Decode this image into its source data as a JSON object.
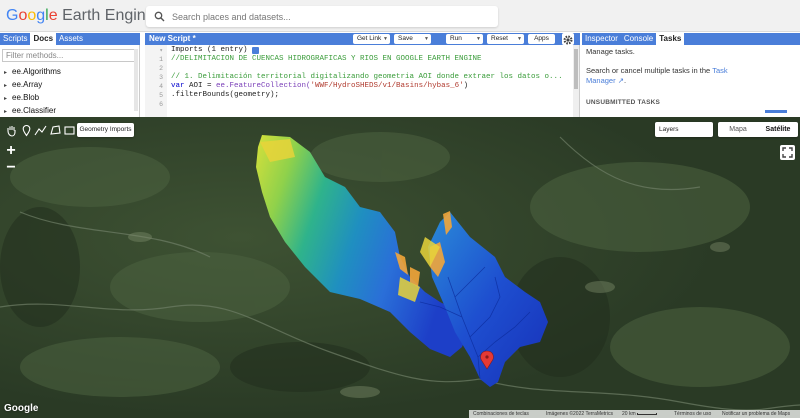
{
  "header": {
    "logo_google": [
      "G",
      "o",
      "o",
      "g",
      "l",
      "e"
    ],
    "logo_rest": " Earth Engine",
    "search_placeholder": "Search places and datasets..."
  },
  "left_panel": {
    "tabs": [
      {
        "label": "Scripts",
        "active": false
      },
      {
        "label": "Docs",
        "active": true
      },
      {
        "label": "Assets",
        "active": false
      }
    ],
    "filter_placeholder": "Filter methods...",
    "items": [
      "ee.Algorithms",
      "ee.Array",
      "ee.Blob",
      "ee.Classifier"
    ]
  },
  "editor": {
    "title": "New Script *",
    "buttons": {
      "get_link": "Get Link",
      "save": "Save",
      "run": "Run",
      "reset": "Reset",
      "apps": "Apps"
    },
    "imports_line": "Imports (1 entry)",
    "lines": [
      {
        "n": "1",
        "text": "//DELIMITACION DE CUENCAS HIDROGRAFICAS Y RIOS EN GOOGLE EARTH ENGINE"
      },
      {
        "n": "2",
        "text": ""
      },
      {
        "n": "3",
        "text": "// 1. Delimitación territorial digitalizando geometria AOI donde extraer los datos o..."
      },
      {
        "n": "4",
        "kw": "var",
        "pre": " AOI = ",
        "fn": "ee.FeatureCollection(",
        "str": "'WWF/HydroSHEDS/v1/Basins/hybas_6'",
        "post": ")"
      },
      {
        "n": "5",
        "text": ".filterBounds(geometry);"
      },
      {
        "n": "6",
        "text": ""
      }
    ]
  },
  "right_panel": {
    "tabs": [
      {
        "label": "Inspector",
        "active": false
      },
      {
        "label": "Console",
        "active": false
      },
      {
        "label": "Tasks",
        "active": true
      }
    ],
    "manage": "Manage tasks.",
    "search_cancel": "Search or cancel multiple tasks in the",
    "task_link": "Task",
    "task_link2": "Manager",
    "period": ".",
    "unsubmitted": "UNSUBMITTED TASKS"
  },
  "map": {
    "geometry_imports": "Geometry Imports",
    "layers": "Layers",
    "map_type": {
      "map": "Mapa",
      "satellite": "Satélite",
      "selected": "Satélite"
    },
    "zoom_in": "+",
    "zoom_out": "−",
    "google": "Google",
    "attribution": {
      "shortcuts": "Combinaciones de teclas",
      "imagery": "Imágenes ©2022 TerraMetrics",
      "scale": "20 km",
      "terms": "Términos de uso",
      "report": "Notificar un problema de Maps"
    }
  },
  "colors": {
    "accent": "#4a7ed9",
    "high_elevation": "#f2a63a",
    "low_elevation": "#1f3fbf",
    "marker": "#e53935"
  }
}
